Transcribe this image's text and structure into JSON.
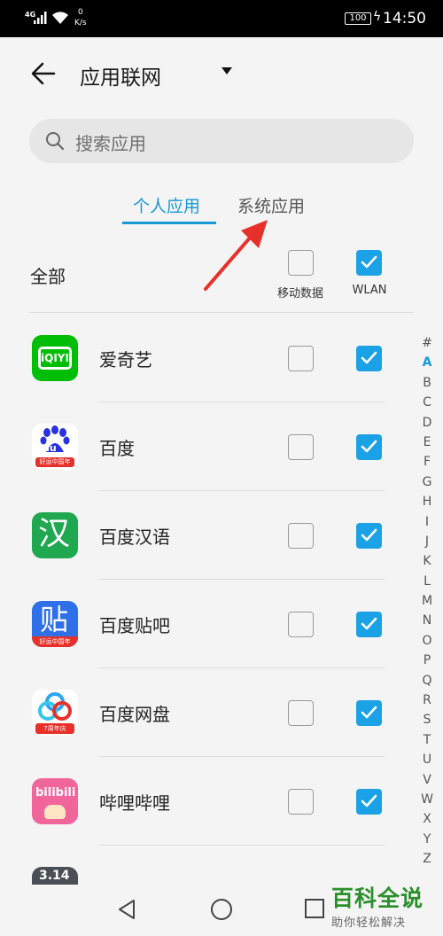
{
  "status_bar": {
    "network": "4G",
    "speed_value": "0",
    "speed_unit": "K/s",
    "battery": "100",
    "time": "14:50"
  },
  "header": {
    "title": "应用联网"
  },
  "search": {
    "placeholder": "搜索应用"
  },
  "tabs": [
    {
      "label": "个人应用",
      "active": true
    },
    {
      "label": "系统应用",
      "active": false
    }
  ],
  "columns": {
    "all_label": "全部",
    "mobile_data": "移动数据",
    "wlan": "WLAN",
    "all_mobile_checked": false,
    "all_wlan_checked": true
  },
  "apps": [
    {
      "name": "爱奇艺",
      "icon": "iqiyi-icon",
      "mobile_data": false,
      "wlan": true
    },
    {
      "name": "百度",
      "icon": "baidu-icon",
      "mobile_data": false,
      "wlan": true
    },
    {
      "name": "百度汉语",
      "icon": "baidu-hanyu-icon",
      "mobile_data": false,
      "wlan": true
    },
    {
      "name": "百度贴吧",
      "icon": "baidu-tieba-icon",
      "mobile_data": false,
      "wlan": true
    },
    {
      "name": "百度网盘",
      "icon": "baidu-netdisk-icon",
      "mobile_data": false,
      "wlan": true
    },
    {
      "name": "哔哩哔哩",
      "icon": "bilibili-icon",
      "mobile_data": false,
      "wlan": true
    }
  ],
  "icon_text": {
    "iqiyi": "iQIYI",
    "baidu": "du",
    "baidu_badge": "好运中国年",
    "hanyu": "汉",
    "tieba": "贴",
    "tieba_badge": "好运中国年",
    "netdisk_badge": "7周年庆",
    "bilibili": "bilibili",
    "partial": "3.14"
  },
  "index_letters": [
    "#",
    "A",
    "B",
    "C",
    "D",
    "E",
    "F",
    "G",
    "H",
    "I",
    "J",
    "K",
    "L",
    "M",
    "N",
    "O",
    "P",
    "Q",
    "R",
    "S",
    "T",
    "U",
    "V",
    "W",
    "X",
    "Y",
    "Z"
  ],
  "index_active": "A",
  "watermark": {
    "title": "百科全说",
    "subtitle": "助你轻松解决"
  },
  "colors": {
    "accent": "#1799d6",
    "checkbox_on": "#1ba1e6",
    "annotation_arrow": "#e8302a"
  }
}
